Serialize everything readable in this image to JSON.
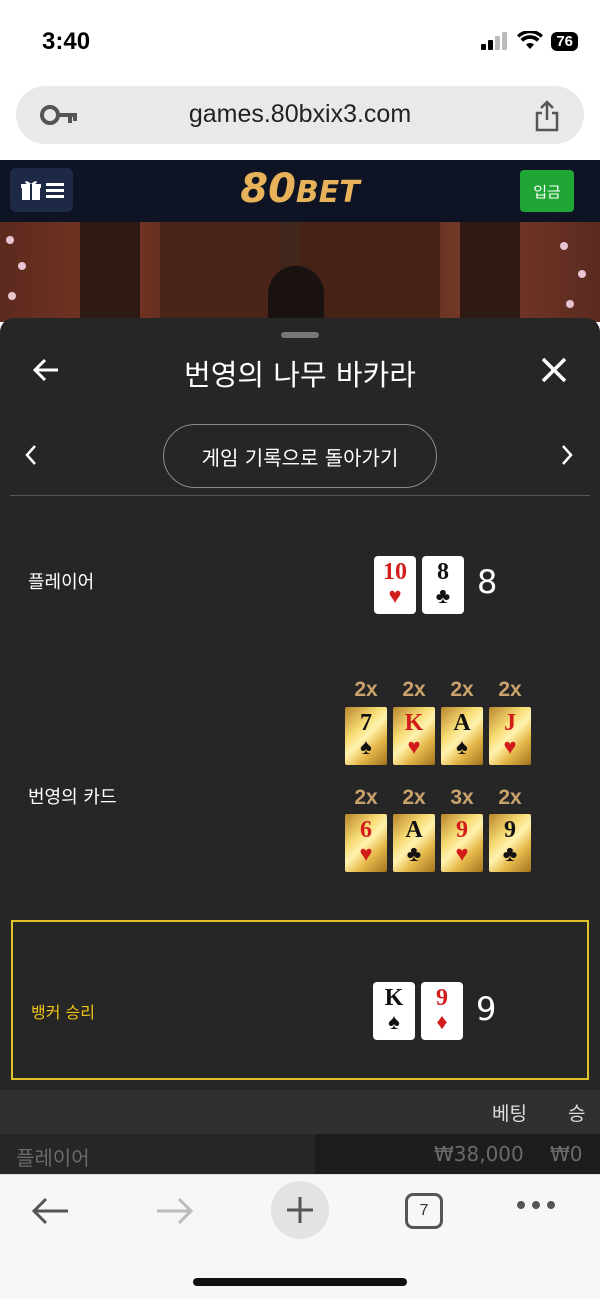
{
  "status_bar": {
    "time": "3:40",
    "battery": "76"
  },
  "browser": {
    "url": "games.80bxix3.com",
    "tab_count": "7"
  },
  "site": {
    "logo_num": "80",
    "logo_bet": "BET",
    "deposit_label": "입금"
  },
  "modal": {
    "title": "번영의 나무 바카라",
    "history_button": "게임 기록으로 돌아가기",
    "player": {
      "label": "플레이어",
      "score": "8",
      "cards": [
        {
          "rank": "10",
          "suit": "♥",
          "color": "red"
        },
        {
          "rank": "8",
          "suit": "♣",
          "color": "black"
        }
      ]
    },
    "prosperity": {
      "label": "번영의 카드",
      "row1": [
        {
          "mult": "2x",
          "rank": "7",
          "suit": "♠",
          "color": "black"
        },
        {
          "mult": "2x",
          "rank": "K",
          "suit": "♥",
          "color": "red"
        },
        {
          "mult": "2x",
          "rank": "A",
          "suit": "♠",
          "color": "black"
        },
        {
          "mult": "2x",
          "rank": "J",
          "suit": "♥",
          "color": "red"
        }
      ],
      "row2": [
        {
          "mult": "2x",
          "rank": "6",
          "suit": "♥",
          "color": "red"
        },
        {
          "mult": "2x",
          "rank": "A",
          "suit": "♣",
          "color": "black"
        },
        {
          "mult": "3x",
          "rank": "9",
          "suit": "♥",
          "color": "red"
        },
        {
          "mult": "2x",
          "rank": "9",
          "suit": "♣",
          "color": "black"
        }
      ]
    },
    "banker": {
      "label": "뱅커 승리",
      "score": "9",
      "cards": [
        {
          "rank": "K",
          "suit": "♠",
          "color": "black"
        },
        {
          "rank": "9",
          "suit": "♦",
          "color": "red"
        }
      ]
    },
    "table": {
      "headers": {
        "bet": "베팅",
        "win": "승"
      },
      "row": {
        "label": "플레이어",
        "bet": "₩38,000",
        "win": "₩0"
      }
    }
  },
  "colors": {
    "accent_gold": "#e3c12a",
    "deposit_green": "#1fa634",
    "header_navy": "#0e1424"
  }
}
